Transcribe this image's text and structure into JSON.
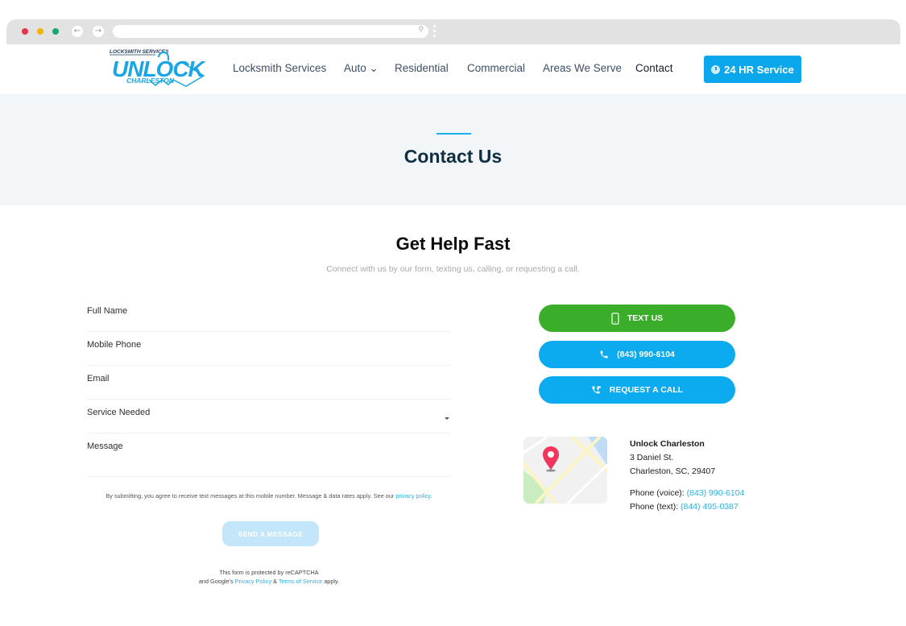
{
  "browser": {
    "traffic_lights": [
      "close",
      "minimize",
      "maximize"
    ],
    "back_icon": "arrow-left-icon",
    "forward_icon": "arrow-right-icon",
    "url": "",
    "search_icon": "search-icon"
  },
  "header": {
    "logo": {
      "tagline": "LOCKSMITH SERVICES",
      "brand_main": "UNLOCK",
      "brand_sub": "CHARLESTON"
    },
    "nav": [
      {
        "label": "Locksmith Services",
        "active": false
      },
      {
        "label": "Auto ⌄",
        "active": false,
        "has_dropdown": true
      },
      {
        "label": "Residential",
        "active": false
      },
      {
        "label": "Commercial",
        "active": false
      },
      {
        "label": "Areas We Serve",
        "active": false
      },
      {
        "label": "Contact",
        "active": true
      }
    ],
    "cta_label": "24 HR Service"
  },
  "hero": {
    "title": "Contact Us"
  },
  "section": {
    "title": "Get Help Fast",
    "subtitle": "Connect with us by our form, texting us, calling, or requesting a call."
  },
  "form": {
    "fields": [
      {
        "label": "Full Name",
        "value": ""
      },
      {
        "label": "Mobile Phone",
        "value": ""
      },
      {
        "label": "Email",
        "value": ""
      },
      {
        "label": "Service Needed",
        "value": "",
        "type": "select"
      },
      {
        "label": "Message",
        "value": ""
      }
    ],
    "disclaimer_text": "By submitting, you agree to receive text messages at this mobile number. Message & data rates apply. See our ",
    "disclaimer_link": "privacy policy",
    "disclaimer_end": ".",
    "submit_label": "SEND A MESSAGE",
    "recaptcha_line1": "This form is protected by reCAPTCHA",
    "recaptcha_pre": "and Google's ",
    "recaptcha_privacy": "Privacy Policy",
    "recaptcha_amp": " & ",
    "recaptcha_terms": "Terms of Service",
    "recaptcha_post": " apply."
  },
  "actions": {
    "text_us": "TEXT US",
    "call": "(843) 990-6104",
    "request_call": "REQUEST A CALL"
  },
  "contact": {
    "name": "Unlock Charleston",
    "address1": "3 Daniel St.",
    "address2": "Charleston, SC, 29407",
    "voice_label": "Phone (voice): ",
    "voice_number": "(843) 990-6104",
    "text_label": "Phone (text): ",
    "text_number": "(844) 495-0387"
  },
  "colors": {
    "brand_blue": "#0ba7ec",
    "text_green": "#3aae2a",
    "hero_bg": "#f2f6f9",
    "heading_dark": "#0f2e3f"
  }
}
